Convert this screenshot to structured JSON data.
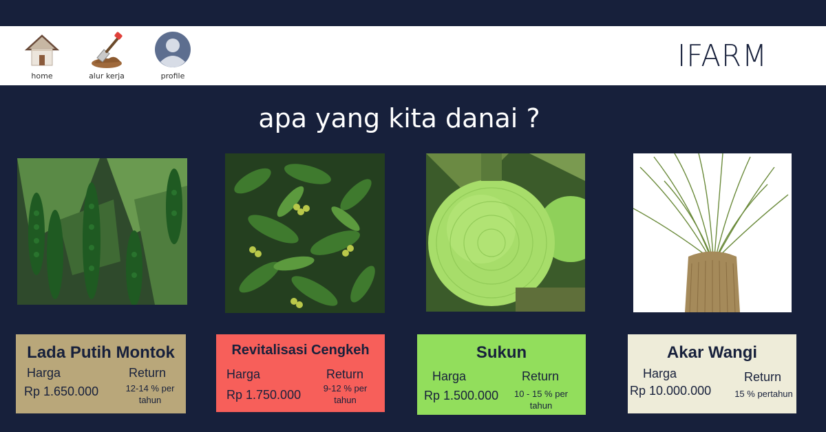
{
  "nav": {
    "items": [
      {
        "label": "home",
        "icon": "house-icon"
      },
      {
        "label": "alur kerja",
        "icon": "shovel-icon"
      },
      {
        "label": "profile",
        "icon": "user-icon"
      }
    ],
    "brand": "IFARM"
  },
  "headline": "apa yang kita danai ?",
  "products": [
    {
      "image": "black-pepper-plant",
      "title": "Lada Putih Montok",
      "price_label": "Harga",
      "return_label": "Return",
      "price": "Rp 1.650.000",
      "return": "12-14 % per tahun",
      "color": "#b9a77a"
    },
    {
      "image": "clove-tree",
      "title": "Revitalisasi Cengkeh",
      "price_label": "Harga",
      "return_label": "Return",
      "price": "Rp 1.750.000",
      "return": "9-12 % per tahun",
      "color": "#f75f5a"
    },
    {
      "image": "breadfruit",
      "title": "Sukun",
      "price_label": "Harga",
      "return_label": "Return",
      "price": "Rp 1.500.000",
      "return": "10 - 15  % per tahun",
      "color": "#92de5c"
    },
    {
      "image": "vetiver-grass",
      "title": "Akar Wangi",
      "price_label": "Harga",
      "return_label": "Return",
      "price": "Rp 10.000.000",
      "return": "15 % pertahun",
      "color": "#eeecd9"
    }
  ],
  "colors": {
    "background": "#17203b",
    "navbar": "#ffffff",
    "text_dark": "#17203b"
  }
}
